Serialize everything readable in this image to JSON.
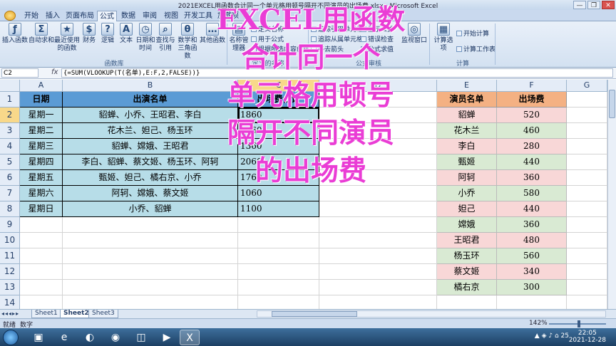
{
  "window": {
    "title": "2021EXCEL用函数合计同一个单元格用顿号隔开不同演员的出场费.xlsx - Microsoft Excel",
    "controls": [
      "—",
      "❐",
      "✕"
    ]
  },
  "ribbon_tabs": [
    "开始",
    "插入",
    "页面布局",
    "公式",
    "数据",
    "审阅",
    "视图",
    "开发工具",
    "加载项"
  ],
  "active_tab": "公式",
  "ribbon": {
    "insert_function": "插入函数",
    "autosum": "自动求和",
    "recent": "最近使用的函数",
    "financial": "财务",
    "logical": "逻辑",
    "text": "文本",
    "datetime": "日期和时间",
    "lookup": "查找与引用",
    "math": "数学和三角函数",
    "more": "其他函数",
    "name_manager": "名称管理器",
    "define_name": "定义名称",
    "use_in_formula": "用于公式",
    "create_from_selection": "根据所选内容创建",
    "trace_precedents": "追踪引用单元格",
    "show_formulas": "显示公式",
    "trace_dependents": "追踪从属单元格",
    "error_checking": "错误检查",
    "remove_arrows": "移去箭头",
    "evaluate_formula": "公式求值",
    "watch_window": "监视窗口",
    "calc_options": "计算选项",
    "calc_now": "开始计算",
    "calc_sheet": "计算工作表",
    "group_library": "函数库",
    "group_names": "定义的名称",
    "group_audit": "公式审核",
    "group_calc": "计算"
  },
  "formula_bar": {
    "name_box": "C2",
    "fx": "fx",
    "formula": "{=SUM(VLOOKUP(T(名单),E:F,2,FALSE))}"
  },
  "columns": [
    "A",
    "B",
    "C",
    "D",
    "E",
    "F",
    "G"
  ],
  "rows": [
    "1",
    "2",
    "3",
    "4",
    "5",
    "6",
    "7",
    "8",
    "9",
    "10",
    "11",
    "12",
    "13",
    "14"
  ],
  "table_left": {
    "headers": [
      "日期",
      "出演名单",
      "出场费合计"
    ],
    "rows": [
      [
        "星期一",
        "貂蝉、小乔、王昭君、李白",
        "1860"
      ],
      [
        "星期二",
        "花木兰、妲己、杨玉环",
        "1460"
      ],
      [
        "星期三",
        "貂蝉、嫦娥、王昭君",
        "1360"
      ],
      [
        "星期四",
        "李白、貂蝉、蔡文姬、杨玉环、阿轲",
        "2060"
      ],
      [
        "星期五",
        "甄姬、妲己、橘右京、小乔",
        "1760"
      ],
      [
        "星期六",
        "阿轲、嫦娥、蔡文姬",
        "1060"
      ],
      [
        "星期日",
        "小乔、貂蝉",
        "1100"
      ]
    ]
  },
  "table_right": {
    "headers": [
      "演员名单",
      "出场费"
    ],
    "rows": [
      [
        "貂蝉",
        "520"
      ],
      [
        "花木兰",
        "460"
      ],
      [
        "李白",
        "280"
      ],
      [
        "甄姬",
        "440"
      ],
      [
        "阿轲",
        "360"
      ],
      [
        "小乔",
        "580"
      ],
      [
        "妲己",
        "440"
      ],
      [
        "嫦娥",
        "360"
      ],
      [
        "王昭君",
        "480"
      ],
      [
        "杨玉环",
        "560"
      ],
      [
        "蔡文姬",
        "340"
      ],
      [
        "橘右京",
        "300"
      ]
    ]
  },
  "overlay_caption": [
    "EXCEL用函数",
    "合计同一个",
    "单元格用顿号",
    "隔开不同演员",
    "的出场费"
  ],
  "sheets": [
    "Sheet1",
    "Sheet2",
    "Sheet3"
  ],
  "active_sheet": "Sheet2",
  "status": {
    "ready": "就绪",
    "mode": "数字",
    "zoom": "142%"
  },
  "taskbar": {
    "time": "22:05",
    "date": "2021-12-28",
    "tray_num": "25"
  },
  "colors": {
    "header_blue": "#5b9bd5",
    "cell_blue": "#b7dde8",
    "header_orange": "#f4b183",
    "cell_pink": "#f8d7d7",
    "cell_green": "#d9ead3",
    "overlay_magenta": "#ea3dd5"
  }
}
